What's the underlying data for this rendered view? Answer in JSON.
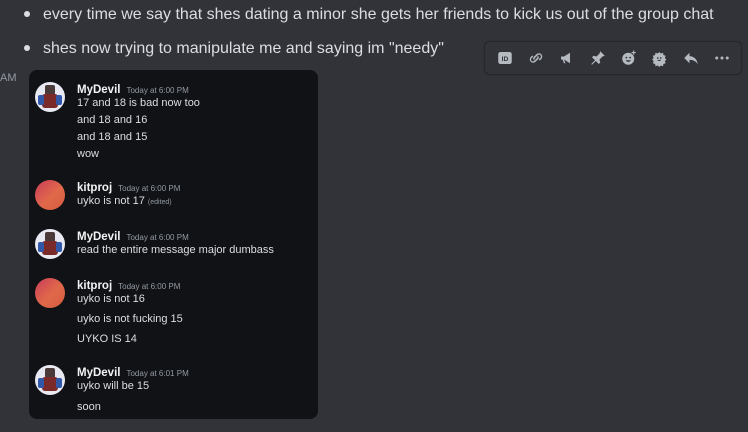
{
  "bullets": [
    "every time we say that shes dating a minor she gets her friends to kick us out of the group chat",
    "shes now trying to manipulate me and saying im \"needy\""
  ],
  "timestamp_fragment": "AM",
  "toolbar": {
    "icons": [
      "id-icon",
      "link-icon",
      "megaphone-icon",
      "pin-icon",
      "add-reaction-icon",
      "super-reaction-icon",
      "reply-icon",
      "more-icon"
    ]
  },
  "screenshot": {
    "messages": [
      {
        "author": "MyDevil",
        "time": "Today at 6:00 PM",
        "lines": [
          "17 and 18 is bad now too",
          "and 18 and 16",
          "and 18 and 15",
          "wow"
        ]
      },
      {
        "author": "kitproj",
        "time": "Today at 6:00 PM",
        "lines": [
          "uyko is not 17"
        ],
        "edited": "(edited)"
      },
      {
        "author": "MyDevil",
        "time": "Today at 6:00 PM",
        "lines": [
          "read the entire message major dumbass"
        ]
      },
      {
        "author": "kitproj",
        "time": "Today at 6:00 PM",
        "lines": [
          "uyko is not 16",
          "uyko is not fucking 15",
          "UYKO IS 14"
        ]
      },
      {
        "author": "MyDevil",
        "time": "Today at 6:01 PM",
        "lines": [
          "uyko will be 15",
          "soon"
        ]
      }
    ]
  }
}
